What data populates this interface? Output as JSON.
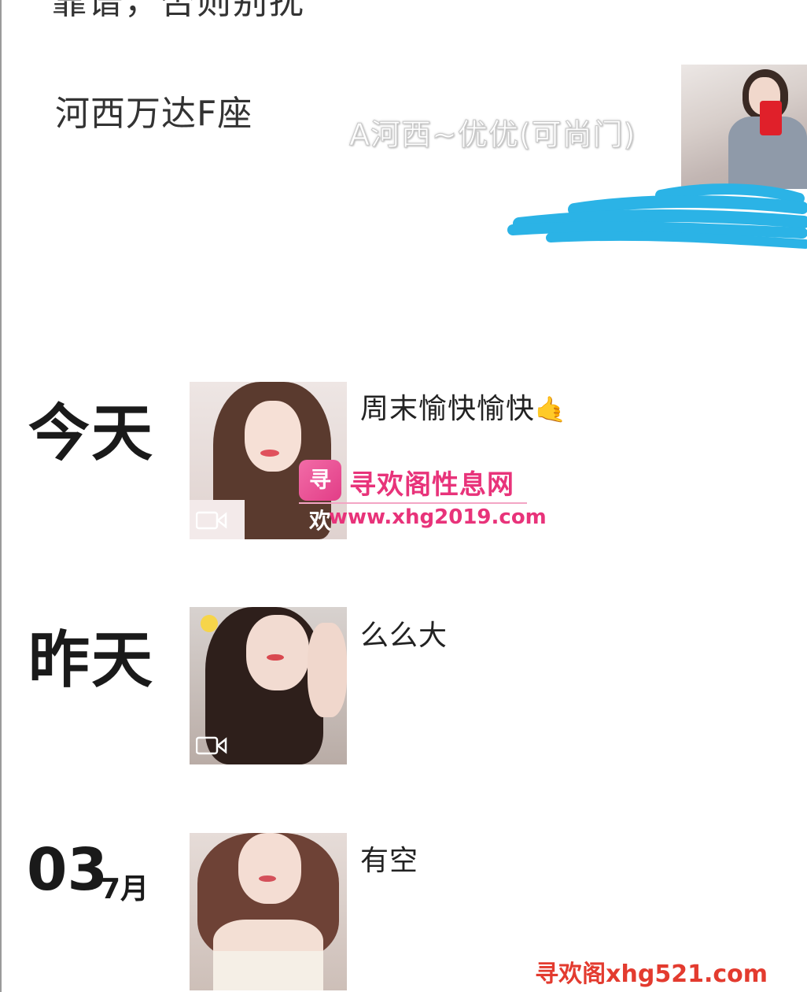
{
  "header": {
    "partial_text": "靠谱，否则别扰",
    "location": "河西万达F座",
    "profile_name": "A河西~优优(可尚门)",
    "avatar": "profile-avatar"
  },
  "timeline": [
    {
      "date_label": "今天",
      "caption": "周末愉快愉快",
      "caption_emoji": "🤙",
      "has_video": true
    },
    {
      "date_label": "昨天",
      "caption": "么么大",
      "has_video": true
    },
    {
      "date_day": "03",
      "date_month": "7月",
      "caption": "有空",
      "has_video": false
    }
  ],
  "watermarks": {
    "center_logo": "寻欢",
    "center_title": "寻欢阁性息网",
    "center_url": "www.xhg2019.com",
    "bottom": "寻欢阁xhg521.com"
  },
  "colors": {
    "redaction": "#2bb3e6",
    "watermark_pink": "#e8337a",
    "watermark_red": "#e33b2f"
  },
  "icons": [
    "video-camera-icon",
    "ok-hand-icon"
  ]
}
